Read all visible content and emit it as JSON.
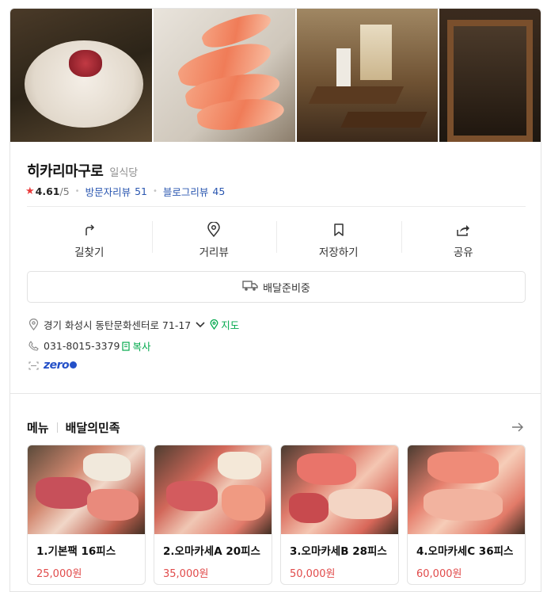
{
  "place": {
    "name": "히카리마구로",
    "category": "일식당",
    "rating": "4.61",
    "rating_total": "/5",
    "visitor_review_label": "방문자리뷰",
    "visitor_review_count": "51",
    "blog_review_label": "블로그리뷰",
    "blog_review_count": "45"
  },
  "actions": [
    {
      "label": "길찾기",
      "icon": "directions-icon"
    },
    {
      "label": "거리뷰",
      "icon": "location-pin-icon"
    },
    {
      "label": "저장하기",
      "icon": "bookmark-icon"
    },
    {
      "label": "공유",
      "icon": "share-icon"
    }
  ],
  "delivery": {
    "label": "배달준비중",
    "icon": "delivery-truck-icon"
  },
  "info": {
    "address": "경기 화성시 동탄문화센터로 71-17",
    "map_link": "지도",
    "phone": "031-8015-3379",
    "copy_link": "복사",
    "zero_pay": "zero"
  },
  "menu_section": {
    "title": "메뉴",
    "subtitle": "배달의민족",
    "items": [
      {
        "name": "1.기본팩 16피스",
        "price": "25,000원"
      },
      {
        "name": "2.오마카세A 20피스",
        "price": "35,000원"
      },
      {
        "name": "3.오마카세B 28피스",
        "price": "50,000원"
      },
      {
        "name": "4.오마카세C 36피스",
        "price": "60,000원"
      }
    ]
  },
  "colors": {
    "accent_green": "#03a94d",
    "link_blue": "#2b57b0",
    "price_red": "#e14b4b",
    "star_red": "#e93c3c"
  }
}
